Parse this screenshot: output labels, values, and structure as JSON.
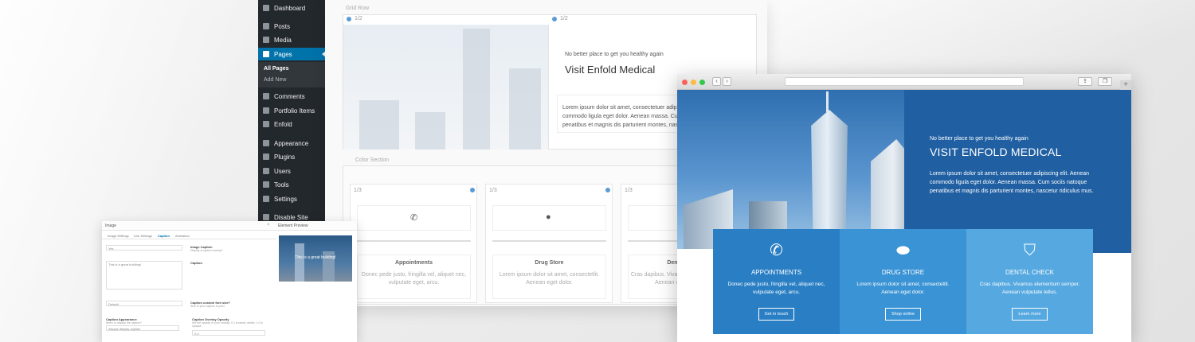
{
  "wp_menu": {
    "items": [
      {
        "label": "Dashboard",
        "icon": "dashboard-icon"
      },
      {
        "label": "Posts",
        "icon": "pin-icon"
      },
      {
        "label": "Media",
        "icon": "media-icon"
      },
      {
        "label": "Pages",
        "icon": "pages-icon"
      },
      {
        "label": "Comments",
        "icon": "comment-icon"
      },
      {
        "label": "Portfolio Items",
        "icon": "portfolio-icon"
      },
      {
        "label": "Enfold",
        "icon": "home-icon"
      },
      {
        "label": "Appearance",
        "icon": "brush-icon"
      },
      {
        "label": "Plugins",
        "icon": "plugin-icon"
      },
      {
        "label": "Users",
        "icon": "users-icon"
      },
      {
        "label": "Tools",
        "icon": "wrench-icon"
      },
      {
        "label": "Settings",
        "icon": "settings-icon"
      },
      {
        "label": "Disable Site",
        "icon": "gear-icon"
      }
    ],
    "submenu": {
      "all_pages": "All Pages",
      "add_new": "Add New"
    }
  },
  "builder": {
    "grid_row_label": "Grid Row",
    "half_label": "1/2",
    "tagline": "No better place to get you healthy again",
    "heading": "Visit Enfold Medical",
    "text": "Lorem ipsum dolor sit amet, consectetuer adipiscing elit. Aenean commodo ligula eget dolor. Aenean massa. Cum sociis natoque penatibus et magnis dis parturient montes, nascetur ridiculus mus.",
    "color_section_label": "Color Section",
    "third_label": "1/3",
    "columns": [
      {
        "title": "Appointments",
        "text": "Donec pede justo, fringilla vel, aliquet nec, vulputate eget, arcu.",
        "icon": "phone-icon"
      },
      {
        "title": "Drug Store",
        "text": "Lorem ipsum dolor sit amet, consectetlit. Aenean eget dolor.",
        "icon": "pill-icon"
      },
      {
        "title": "Dental Check",
        "text": "Cras dapibus. Vivamus elementum semper. Aenean vulputate tellus.",
        "icon": "tooth-icon"
      }
    ]
  },
  "modal": {
    "title": "Image",
    "preview_title": "Element Preview",
    "tabs": [
      "Image Settings",
      "Link Settings",
      "Caption",
      "Animation"
    ],
    "active_tab": "Caption",
    "caption_select": "Yes",
    "caption_label": "Image Caption",
    "caption_desc": "Display a caption overlay?",
    "caption_textarea": "This is a great building!",
    "caption_field_label": "Caption",
    "font_select": "Default",
    "font_label": "Caption custom font size?",
    "font_desc": "Size of your caption in pixel",
    "appearance_label": "Caption Appearance",
    "appearance_desc": "When to display the caption?",
    "appearance_select": "Always display caption",
    "opacity_label": "Caption Overlay Opacity",
    "opacity_desc": "Set the opacity of your overlay: 0.1 is barely visible, 1.0 is opaque",
    "opacity_select": "0.4",
    "preview_caption": "This is a great building!"
  },
  "site": {
    "tagline": "No better place to get you healthy again",
    "title": "VISIT ENFOLD MEDICAL",
    "text": "Lorem ipsum dolor sit amet, consectetuer adipiscing elit. Aenean commodo ligula eget dolor. Aenean massa. Cum sociis natoque penatibus et magnis dis parturient montes, nascetur ridiculus mus.",
    "features": [
      {
        "title": "APPOINTMENTS",
        "text": "Donec pede justo, fringilla vel, aliquet nec, vulputate eget, arcu.",
        "button": "Get in touch",
        "color": "#2a7fc4",
        "icon": "phone-icon"
      },
      {
        "title": "DRUG STORE",
        "text": "Lorem ipsum dolor sit amet, consectetlit. Aenean eget dolor.",
        "button": "Shop online",
        "color": "#3a93d4",
        "icon": "pill-icon"
      },
      {
        "title": "DENTAL CHECK",
        "text": "Cras dapibus. Vivamus elementum semper. Aenean vulputate tellus.",
        "button": "Learn more",
        "color": "#55a8e0",
        "icon": "tooth-icon"
      }
    ]
  },
  "colors": {
    "wp_sidebar": "#23282d",
    "wp_active": "#0073aa",
    "hero_blue": "#1f5fa2",
    "accent_dot": "#5b9bd5"
  }
}
